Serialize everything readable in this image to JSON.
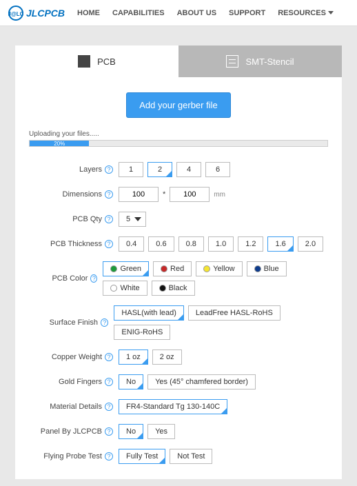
{
  "header": {
    "brand": "JLCPCB",
    "nav": [
      "HOME",
      "CAPABILITIES",
      "ABOUT US",
      "SUPPORT",
      "RESOURCES"
    ]
  },
  "tabs": {
    "pcb": "PCB",
    "stencil": "SMT-Stencil"
  },
  "gerber_button": "Add your gerber file",
  "upload": {
    "label": "Uploading your files.....",
    "percent_text": "20%",
    "percent": 20
  },
  "form": {
    "layers": {
      "label": "Layers",
      "options": [
        "1",
        "2",
        "4",
        "6"
      ],
      "selected": "2"
    },
    "dimensions": {
      "label": "Dimensions",
      "width": "100",
      "height": "100",
      "unit": "mm"
    },
    "pcb_qty": {
      "label": "PCB Qty",
      "value": "5"
    },
    "thickness": {
      "label": "PCB Thickness",
      "options": [
        "0.4",
        "0.6",
        "0.8",
        "1.0",
        "1.2",
        "1.6",
        "2.0"
      ],
      "selected": "1.6"
    },
    "color": {
      "label": "PCB Color",
      "options": [
        {
          "name": "Green",
          "hex": "#1c9b3a"
        },
        {
          "name": "Red",
          "hex": "#c62828"
        },
        {
          "name": "Yellow",
          "hex": "#f5e531"
        },
        {
          "name": "Blue",
          "hex": "#0d3b8c"
        },
        {
          "name": "White",
          "hex": "#ffffff"
        },
        {
          "name": "Black",
          "hex": "#111111"
        }
      ],
      "selected": "Green"
    },
    "surface_finish": {
      "label": "Surface Finish",
      "options": [
        "HASL(with lead)",
        "LeadFree HASL-RoHS",
        "ENIG-RoHS"
      ],
      "selected": "HASL(with lead)"
    },
    "copper_weight": {
      "label": "Copper Weight",
      "options": [
        "1 oz",
        "2 oz"
      ],
      "selected": "1 oz"
    },
    "gold_fingers": {
      "label": "Gold Fingers",
      "options": [
        "No",
        "Yes (45° chamfered border)"
      ],
      "selected": "No"
    },
    "material_details": {
      "label": "Material Details",
      "options": [
        "FR4-Standard Tg 130-140C"
      ],
      "selected": "FR4-Standard Tg 130-140C"
    },
    "panel_by": {
      "label": "Panel By JLCPCB",
      "options": [
        "No",
        "Yes"
      ],
      "selected": "No"
    },
    "flying_probe": {
      "label": "Flying Probe Test",
      "options": [
        "Fully Test",
        "Not Test"
      ],
      "selected": "Fully Test"
    }
  }
}
